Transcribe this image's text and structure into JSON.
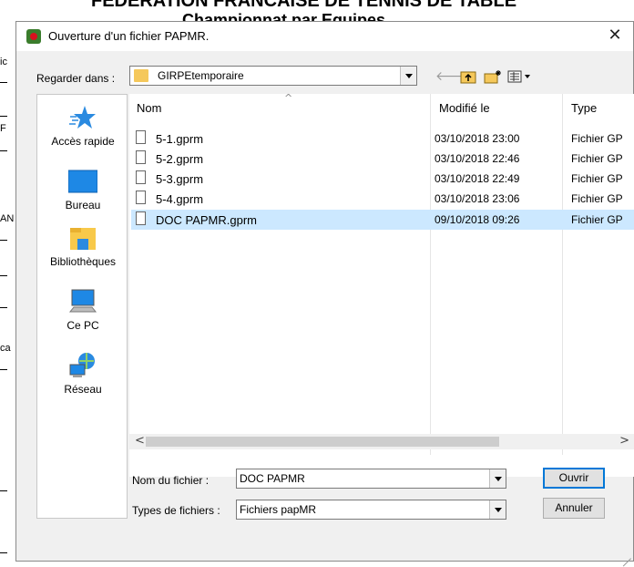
{
  "background_window": {
    "title_line1": "FEDERATION FRANCAISE DE TENNIS DE TABLE",
    "title_line2": "Championnat par Equipes",
    "edge_fragments": [
      "ic",
      "F",
      "AN",
      "ca"
    ]
  },
  "dialog": {
    "title": "Ouverture d'un fichier PAPMR.",
    "close_glyph": "✕"
  },
  "lookin": {
    "label": "Regarder dans :",
    "value": "GIRPEtemporaire"
  },
  "toolbar": {
    "back_glyph": "🡐",
    "up_glyph": "⬆",
    "new_folder_glyph": "✱",
    "view_glyph": "▦▾"
  },
  "places": [
    {
      "label": "Accès rapide",
      "icon": "star-icon"
    },
    {
      "label": "Bureau",
      "icon": "desktop-icon"
    },
    {
      "label": "Bibliothèques",
      "icon": "libraries-icon"
    },
    {
      "label": "Ce PC",
      "icon": "computer-icon"
    },
    {
      "label": "Réseau",
      "icon": "network-icon"
    }
  ],
  "columns": {
    "name": "Nom",
    "modified": "Modifié le",
    "type": "Type"
  },
  "files": [
    {
      "name": "5-1.gprm",
      "modified": "03/10/2018 23:00",
      "type": "Fichier GP"
    },
    {
      "name": "5-2.gprm",
      "modified": "03/10/2018 22:46",
      "type": "Fichier GP"
    },
    {
      "name": "5-3.gprm",
      "modified": "03/10/2018 22:49",
      "type": "Fichier GP"
    },
    {
      "name": "5-4.gprm",
      "modified": "03/10/2018 23:06",
      "type": "Fichier GP"
    },
    {
      "name": "DOC PAPMR.gprm",
      "modified": "09/10/2018 09:26",
      "type": "Fichier GP",
      "selected": true
    }
  ],
  "scroll": {
    "left_glyph": "<",
    "right_glyph": ">"
  },
  "filename": {
    "label": "Nom du fichier :",
    "value": "DOC PAPMR"
  },
  "filetype": {
    "label": "Types de fichiers :",
    "value": "Fichiers papMR"
  },
  "buttons": {
    "open": "Ouvrir",
    "cancel": "Annuler"
  },
  "colors": {
    "selection": "#cce8ff",
    "dialog_bg": "#f0f0f0",
    "default_button_border": "#0078d7"
  }
}
